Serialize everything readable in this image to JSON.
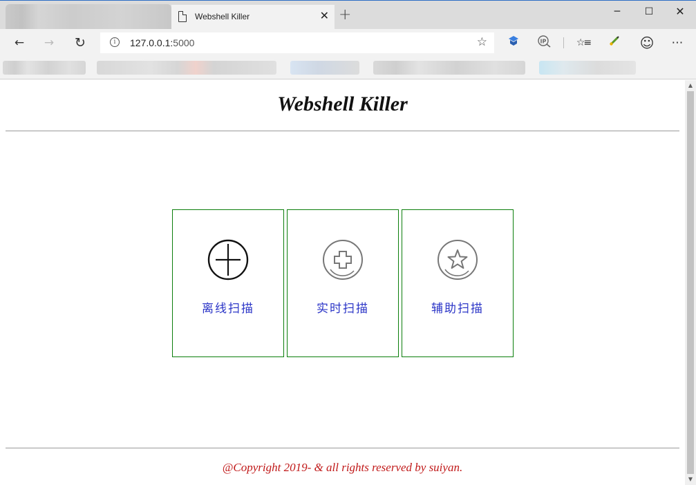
{
  "browser": {
    "tab": {
      "title": "Webshell Killer",
      "close": "✕",
      "icon": "page-icon"
    },
    "new_tab": "+",
    "window_controls": {
      "minimize": "─",
      "maximize": "☐",
      "close": "✕"
    },
    "toolbar": {
      "back": "←",
      "forward": "→",
      "refresh": "↻",
      "address_host": "127.0.0.1:",
      "address_port": "5000",
      "favorite": "☆",
      "more": "⋯",
      "emoji": "☺",
      "favorites_hub": "☆≡"
    }
  },
  "page": {
    "title": "Webshell Killer",
    "cards": [
      {
        "label": "离线扫描",
        "icon": "crosshair-circle-icon"
      },
      {
        "label": "实时扫描",
        "icon": "plus-circle-icon"
      },
      {
        "label": "辅助扫描",
        "icon": "star-circle-icon"
      }
    ],
    "footer": "@Copyright 2019- & all rights reserved by suiyan."
  },
  "colors": {
    "card_border": "#0a7d0a",
    "card_label": "#2b35c7",
    "footer_text": "#c01818"
  }
}
